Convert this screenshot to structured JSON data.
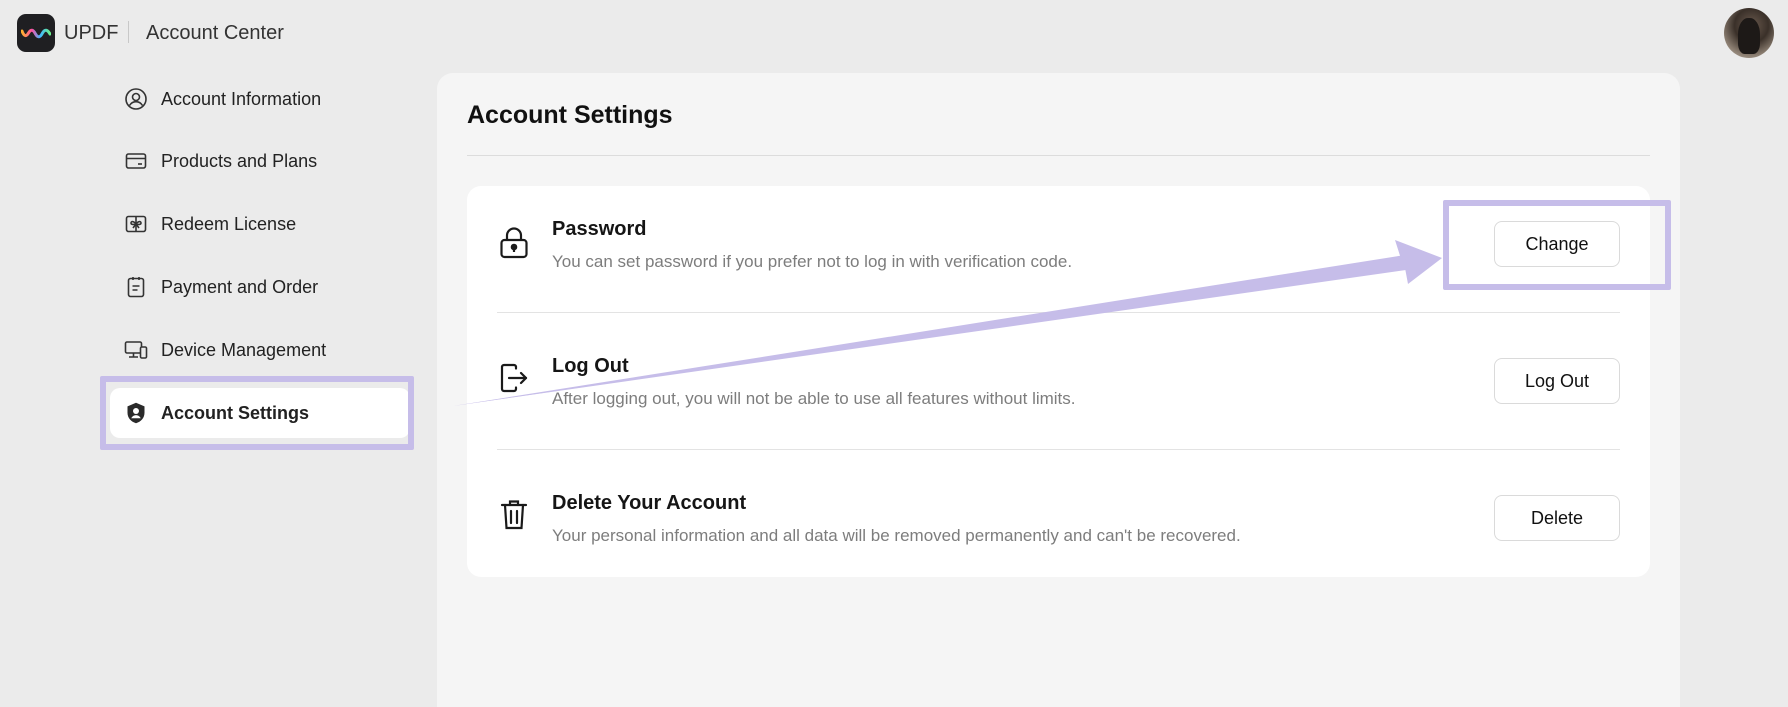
{
  "header": {
    "brand": "UPDF",
    "app_title": "Account Center"
  },
  "sidebar": {
    "items": [
      {
        "label": "Account Information",
        "icon": "user-circle-icon"
      },
      {
        "label": "Products and Plans",
        "icon": "card-icon"
      },
      {
        "label": "Redeem License",
        "icon": "gift-icon"
      },
      {
        "label": "Payment and Order",
        "icon": "clipboard-icon"
      },
      {
        "label": "Device Management",
        "icon": "devices-icon"
      },
      {
        "label": "Account Settings",
        "icon": "shield-user-icon",
        "active": true
      }
    ]
  },
  "main": {
    "title": "Account Settings",
    "settings": [
      {
        "title": "Password",
        "description": "You can set password if you prefer not to log in with verification code.",
        "button": "Change",
        "icon": "lock-icon"
      },
      {
        "title": "Log Out",
        "description": "After logging out, you will not be able to use all features without limits.",
        "button": "Log Out",
        "icon": "logout-icon"
      },
      {
        "title": "Delete Your Account",
        "description": "Your personal information and all data will be removed permanently and can't be recovered.",
        "button": "Delete",
        "icon": "trash-icon"
      }
    ]
  },
  "colors": {
    "background": "#ebebeb",
    "panel": "#f5f5f5",
    "annotation": "#c6bde9"
  }
}
